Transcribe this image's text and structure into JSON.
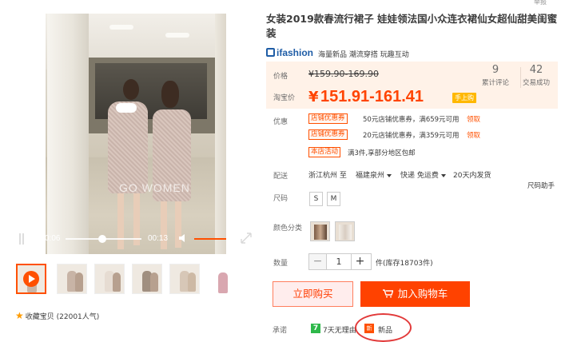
{
  "top": {
    "report": "举报"
  },
  "video": {
    "current_time": "0:06",
    "duration": "00:13",
    "watermark": "GO WOMEN",
    "progress": 0.45
  },
  "thumbnails": [
    "video",
    "photo-2",
    "photo-3",
    "photo-4",
    "photo-5",
    "photo-6"
  ],
  "favorite": {
    "icon": "star-icon",
    "label": "收藏宝贝 (22001人气)"
  },
  "product": {
    "title": "女装2019款春流行裙子 娃娃领法国小众连衣裙仙女超仙甜美闺蜜装",
    "brand": "ifashion",
    "brand_tagline": "海量新品 潮流穿搭 玩趣互动"
  },
  "price": {
    "label": "价格",
    "original": "¥159.90-169.90",
    "taobao_label": "淘宝价",
    "currency": "¥",
    "value": "151.91-161.41",
    "mobile_badge": "手上购"
  },
  "stats": [
    {
      "value": "9",
      "label": "累计评论"
    },
    {
      "value": "42",
      "label": "交易成功"
    }
  ],
  "promotions": {
    "label": "优惠",
    "coupons": [
      {
        "tag": "店铺优惠券",
        "text": "50元店铺优惠券，满659元可用",
        "link": "领取"
      },
      {
        "tag": "店铺优惠券",
        "text": "20元店铺优惠券，满359元可用",
        "link": "领取"
      }
    ],
    "activity_tag": "本店活动",
    "activity_text": "满3件,享部分地区包邮"
  },
  "shipping": {
    "label": "配送",
    "from": "浙江杭州 至",
    "to": "福建泉州",
    "method": "快递 免运费",
    "ship_time": "20天内发货"
  },
  "size": {
    "label": "尺码",
    "options": [
      "S",
      "M"
    ],
    "help": "尺码助手"
  },
  "color": {
    "label": "颜色分类",
    "options": [
      "color-1",
      "color-2"
    ]
  },
  "quantity": {
    "label": "数量",
    "minus": "−",
    "value": "1",
    "plus": "+",
    "stock": "件(库存18703件)"
  },
  "actions": {
    "buy_now": "立即购买",
    "add_to_cart": "加入购物车"
  },
  "promise": {
    "label": "承诺",
    "return_icon": "7",
    "return_text": "7天无理由",
    "new_icon": "新",
    "new_text": "新品"
  },
  "colors": {
    "accent": "#ff5000",
    "price": "#ff4400",
    "annotation": "#e23a3a"
  }
}
